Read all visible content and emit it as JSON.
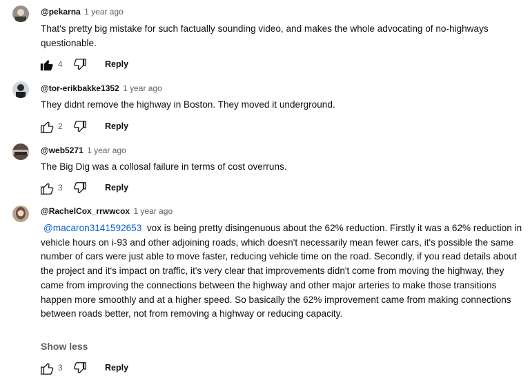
{
  "comments": [
    {
      "author": "@pekarna",
      "time": "1 year ago",
      "text": "That's pretty big mistake for such factually sounding video, and makes the whole advocating of no-highways questionable.",
      "likes": "4",
      "liked": true,
      "reply_label": "Reply"
    },
    {
      "author": "@tor-erikbakke1352",
      "time": "1 year ago",
      "text": "They didnt remove the highway in Boston. They moved it underground.",
      "likes": "2",
      "liked": false,
      "reply_label": "Reply"
    },
    {
      "author": "@web5271",
      "time": "1 year ago",
      "text": "The Big Dig was a collosal failure in terms of cost overruns.",
      "likes": "3",
      "liked": false,
      "reply_label": "Reply"
    },
    {
      "author": "@RachelCox_rrwwcox",
      "time": "1 year ago",
      "mention": "@macaron3141592653",
      "text": "vox is being pretty disingenuous about the 62% reduction. Firstly it was a 62% reduction in vehicle hours on i-93 and other adjoining roads, which doesn't necessarily mean fewer cars, it's possible the same number of cars were just able to move faster, reducing vehicle time on the road. Secondly, if you read details about the project and it's impact on traffic, it's very clear that improvements didn't come from moving the highway, they came from improving the connections between the highway and other major arteries to make those transitions happen more smoothly and at a higher speed. So basically the 62% improvement came from making connections between roads better, not from removing a highway or reducing capacity.",
      "show_less_label": "Show less",
      "likes": "3",
      "liked": false,
      "reply_label": "Reply"
    }
  ]
}
